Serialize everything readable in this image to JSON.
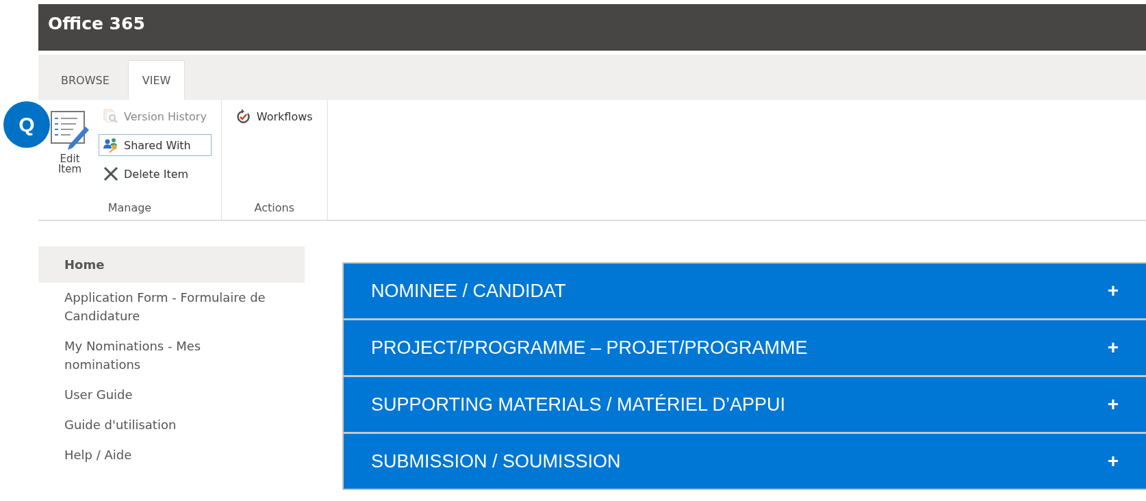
{
  "badge": {
    "label": "Q"
  },
  "header": {
    "title": "Office 365"
  },
  "ribbon": {
    "tabs": [
      {
        "label": "BROWSE",
        "selected": false
      },
      {
        "label": "VIEW",
        "selected": true
      }
    ],
    "groups": [
      {
        "label": "Manage",
        "items": [
          {
            "kind": "large",
            "label": "Edit Item",
            "disabled": false,
            "selected": false
          },
          {
            "kind": "small",
            "label": "Version History",
            "disabled": true,
            "selected": false
          },
          {
            "kind": "small",
            "label": "Shared With",
            "disabled": false,
            "selected": true
          },
          {
            "kind": "small",
            "label": "Delete Item",
            "disabled": false,
            "selected": false
          }
        ]
      },
      {
        "label": "Actions",
        "items": [
          {
            "kind": "small",
            "label": "Workflows",
            "disabled": false,
            "selected": false
          }
        ]
      }
    ]
  },
  "sidebar": {
    "items": [
      {
        "label": "Home",
        "selected": true
      },
      {
        "label": "Application Form - Formulaire de Candidature",
        "selected": false
      },
      {
        "label": "My Nominations - Mes nominations",
        "selected": false
      },
      {
        "label": "User Guide",
        "selected": false
      },
      {
        "label": "Guide d'utilisation",
        "selected": false
      },
      {
        "label": "Help / Aide",
        "selected": false
      }
    ]
  },
  "sections": [
    {
      "title": "NOMINEE / CANDIDAT",
      "toggle": "+"
    },
    {
      "title": "PROJECT/PROGRAMME – PROJET/PROGRAMME",
      "toggle": "+"
    },
    {
      "title": "SUPPORTING MATERIALS / MATÉRIEL D’APPUI",
      "toggle": "+"
    },
    {
      "title": "SUBMISSION / SOUMISSION",
      "toggle": "+"
    }
  ]
}
